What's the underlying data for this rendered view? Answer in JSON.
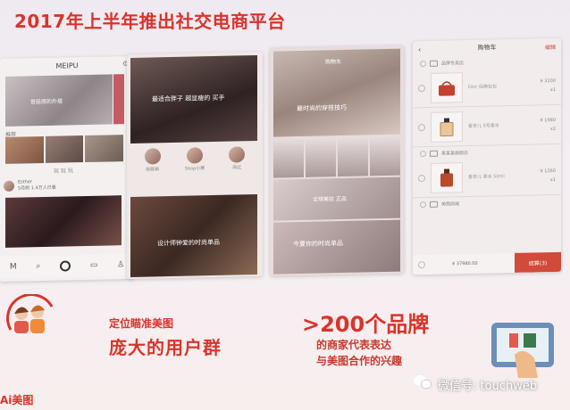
{
  "title": "2017年上半年推出社交电商平台",
  "phone1": {
    "app_name": "MEIPU",
    "hero_caption": "宫廷感的外搭",
    "section_label": "推荐",
    "caption": "玩 玩 玩",
    "user_name": "Esther",
    "user_meta": "5月前 1.4万人已看"
  },
  "phone2": {
    "hero_caption": "最适合胖子 超显瘦的 买手",
    "avatars": [
      "徐筱娟",
      "Shop小赛",
      "网红"
    ],
    "pic_caption": "设计师钟爱的时尚单品"
  },
  "phone3": {
    "hero_tag": "购物车",
    "hero_caption": "最时尚的穿搭技巧",
    "mid_caption": "全球美妆 正品",
    "bot_caption": "今夏你的时尚单品"
  },
  "cart": {
    "title": "购物车",
    "edit_label": "编辑",
    "items": [
      {
        "seller": "品牌专卖店",
        "name": "Dior 经典包包",
        "price": "¥ 3200",
        "qty": "x1",
        "icon": "handbag-icon"
      },
      {
        "seller": "",
        "name": "香奈儿 5号香水",
        "price": "¥ 1980",
        "qty": "x2",
        "icon": "perfume-icon"
      },
      {
        "seller": "某某某旗舰店",
        "name": "香奈儿 香水 50ml",
        "price": "¥ 1260",
        "qty": "x1",
        "icon": "perfume-icon"
      }
    ],
    "footer_seller": "美图商城",
    "total": "¥ 37980.00",
    "pay_label": "结算(3)"
  },
  "bottom": {
    "left_line1": "定位瞄准美图",
    "left_line2": "庞大的用户群",
    "right_line1": ">200个品牌",
    "right_line2": "的商家代表表达",
    "right_line3": "与美图合作的兴趣",
    "brand": "Ai美图",
    "watermark": "微信号: touchweb"
  },
  "colors": {
    "accent": "#d9342b",
    "pay": "#d24a3a"
  }
}
